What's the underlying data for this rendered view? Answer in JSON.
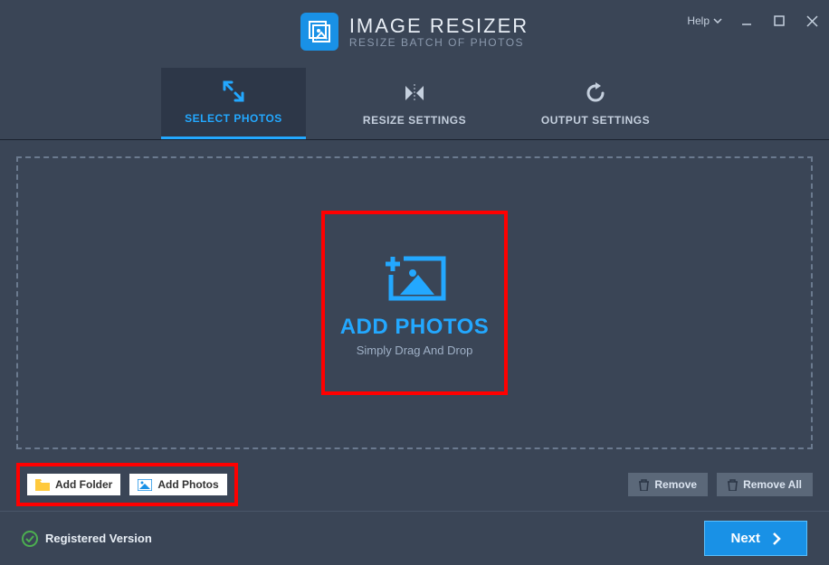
{
  "app": {
    "title": "IMAGE RESIZER",
    "subtitle": "RESIZE BATCH OF PHOTOS"
  },
  "titlebar": {
    "help_label": "Help"
  },
  "tabs": {
    "select_photos": "SELECT PHOTOS",
    "resize_settings": "RESIZE SETTINGS",
    "output_settings": "OUTPUT SETTINGS"
  },
  "dropzone": {
    "title": "ADD PHOTOS",
    "hint": "Simply Drag And Drop"
  },
  "buttons": {
    "add_folder": "Add Folder",
    "add_photos": "Add Photos",
    "remove": "Remove",
    "remove_all": "Remove All"
  },
  "footer": {
    "status": "Registered Version",
    "next": "Next"
  }
}
